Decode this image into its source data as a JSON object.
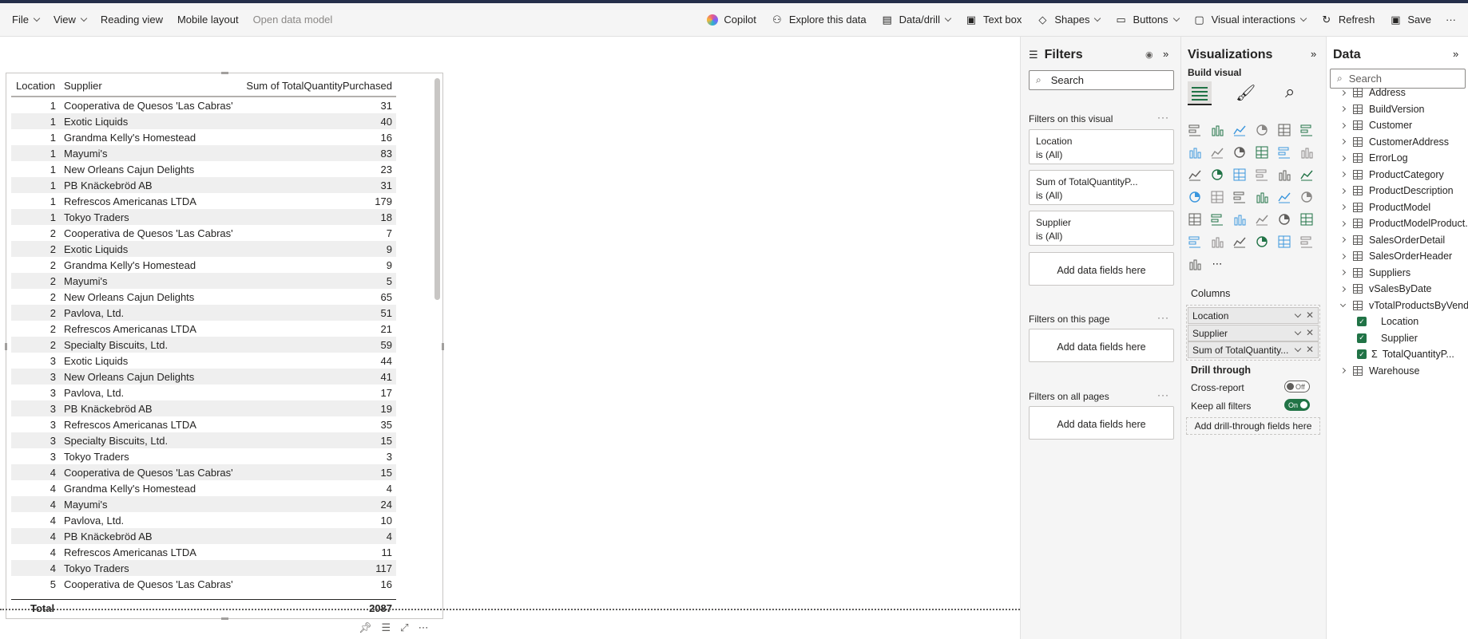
{
  "toolbar": {
    "left": [
      {
        "label": "File",
        "chevron": true,
        "disabled": false
      },
      {
        "label": "View",
        "chevron": true,
        "disabled": false
      },
      {
        "label": "Reading view",
        "chevron": false,
        "disabled": false
      },
      {
        "label": "Mobile layout",
        "chevron": false,
        "disabled": false
      },
      {
        "label": "Open data model",
        "chevron": false,
        "disabled": true
      }
    ],
    "right": [
      {
        "label": "Copilot",
        "icon": "copilot-icon",
        "chevron": false
      },
      {
        "label": "Explore this data",
        "icon": "binoculars-icon",
        "chevron": false
      },
      {
        "label": "Data/drill",
        "icon": "data-drill-icon",
        "chevron": true
      },
      {
        "label": "Text box",
        "icon": "text-box-icon",
        "chevron": false
      },
      {
        "label": "Shapes",
        "icon": "shapes-icon",
        "chevron": true
      },
      {
        "label": "Buttons",
        "icon": "buttons-icon",
        "chevron": true
      },
      {
        "label": "Visual interactions",
        "icon": "visual-interactions-icon",
        "chevron": true
      },
      {
        "label": "Refresh",
        "icon": "refresh-icon",
        "chevron": false
      },
      {
        "label": "Save",
        "icon": "save-icon",
        "chevron": false
      },
      {
        "label": "···",
        "icon": "",
        "chevron": false
      }
    ]
  },
  "table": {
    "headers": {
      "location": "Location",
      "supplier": "Supplier",
      "quantity": "Sum of TotalQuantityPurchased"
    },
    "rows": [
      [
        "1",
        "Cooperativa de Quesos 'Las Cabras'",
        "31"
      ],
      [
        "1",
        "Exotic Liquids",
        "40"
      ],
      [
        "1",
        "Grandma Kelly's Homestead",
        "16"
      ],
      [
        "1",
        "Mayumi's",
        "83"
      ],
      [
        "1",
        "New Orleans Cajun Delights",
        "23"
      ],
      [
        "1",
        "PB Knäckebröd AB",
        "31"
      ],
      [
        "1",
        "Refrescos Americanas LTDA",
        "179"
      ],
      [
        "1",
        "Tokyo Traders",
        "18"
      ],
      [
        "2",
        "Cooperativa de Quesos 'Las Cabras'",
        "7"
      ],
      [
        "2",
        "Exotic Liquids",
        "9"
      ],
      [
        "2",
        "Grandma Kelly's Homestead",
        "9"
      ],
      [
        "2",
        "Mayumi's",
        "5"
      ],
      [
        "2",
        "New Orleans Cajun Delights",
        "65"
      ],
      [
        "2",
        "Pavlova, Ltd.",
        "51"
      ],
      [
        "2",
        "Refrescos Americanas LTDA",
        "21"
      ],
      [
        "2",
        "Specialty Biscuits, Ltd.",
        "59"
      ],
      [
        "3",
        "Exotic Liquids",
        "44"
      ],
      [
        "3",
        "New Orleans Cajun Delights",
        "41"
      ],
      [
        "3",
        "Pavlova, Ltd.",
        "17"
      ],
      [
        "3",
        "PB Knäckebröd AB",
        "19"
      ],
      [
        "3",
        "Refrescos Americanas LTDA",
        "35"
      ],
      [
        "3",
        "Specialty Biscuits, Ltd.",
        "15"
      ],
      [
        "3",
        "Tokyo Traders",
        "3"
      ],
      [
        "4",
        "Cooperativa de Quesos 'Las Cabras'",
        "15"
      ],
      [
        "4",
        "Grandma Kelly's Homestead",
        "4"
      ],
      [
        "4",
        "Mayumi's",
        "24"
      ],
      [
        "4",
        "Pavlova, Ltd.",
        "10"
      ],
      [
        "4",
        "PB Knäckebröd AB",
        "4"
      ],
      [
        "4",
        "Refrescos Americanas LTDA",
        "11"
      ],
      [
        "4",
        "Tokyo Traders",
        "117"
      ],
      [
        "5",
        "Cooperativa de Quesos 'Las Cabras'",
        "16"
      ]
    ],
    "total_label": "Total",
    "total_value": "2087"
  },
  "filters": {
    "title": "Filters",
    "search_placeholder": "Search",
    "on_visual_label": "Filters on this visual",
    "visual_filters": [
      {
        "name": "Location",
        "state": "is (All)"
      },
      {
        "name": "Sum of TotalQuantityP...",
        "state": "is (All)"
      },
      {
        "name": "Supplier",
        "state": "is (All)"
      }
    ],
    "add_fields": "Add data fields here",
    "on_page_label": "Filters on this page",
    "on_all_pages_label": "Filters on all pages"
  },
  "visualizations": {
    "title": "Visualizations",
    "build_visual": "Build visual",
    "columns_label": "Columns",
    "wells": [
      "Location",
      "Supplier",
      "Sum of TotalQuantity..."
    ],
    "drill_through": "Drill through",
    "cross_report": "Cross-report",
    "cross_report_state": "Off",
    "keep_all_filters": "Keep all filters",
    "keep_all_filters_state": "On",
    "add_drill": "Add drill-through fields here"
  },
  "data_pane": {
    "title": "Data",
    "search_placeholder": "Search",
    "tables": [
      "Address",
      "BuildVersion",
      "Customer",
      "CustomerAddress",
      "ErrorLog",
      "ProductCategory",
      "ProductDescription",
      "ProductModel",
      "ProductModelProduct...",
      "SalesOrderDetail",
      "SalesOrderHeader",
      "Suppliers",
      "vSalesByDate"
    ],
    "expanded_table": "vTotalProductsByVend...",
    "expanded_fields": [
      {
        "name": "Location",
        "sigma": false
      },
      {
        "name": "Supplier",
        "sigma": false
      },
      {
        "name": "TotalQuantityP...",
        "sigma": true
      }
    ],
    "last_table": "Warehouse"
  }
}
